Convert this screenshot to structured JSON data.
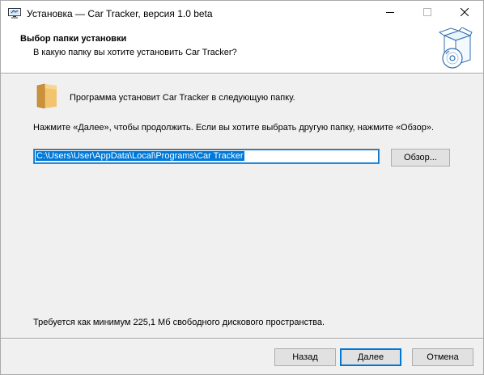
{
  "window": {
    "title": "Установка — Car Tracker, версия 1.0 beta",
    "app_icon": "installer-monitor-icon",
    "controls": {
      "minimize": "minimize-icon",
      "maximize": "maximize-icon",
      "close": "close-icon"
    }
  },
  "header": {
    "title": "Выбор папки установки",
    "subtitle": "В какую папку вы хотите установить Car Tracker?",
    "art_icon": "setup-box-disc-icon"
  },
  "body": {
    "folder_icon": "folder-icon",
    "folder_message": "Программа установит Car Tracker в следующую папку.",
    "instruction": "Нажмите «Далее», чтобы продолжить. Если вы хотите выбрать другую папку, нажмите «Обзор».",
    "path_value": "C:\\Users\\User\\AppData\\Local\\Programs\\Car Tracker",
    "browse_label": "Обзор...",
    "space_required": "Требуется как минимум 225,1 Мб свободного дискового пространства."
  },
  "footer": {
    "back_label": "Назад",
    "next_label": "Далее",
    "cancel_label": "Отмена"
  },
  "colors": {
    "accent": "#0078d7",
    "window_bg": "#f0f0f0",
    "header_bg": "#ffffff",
    "folder_yellow": "#e8b65a"
  }
}
